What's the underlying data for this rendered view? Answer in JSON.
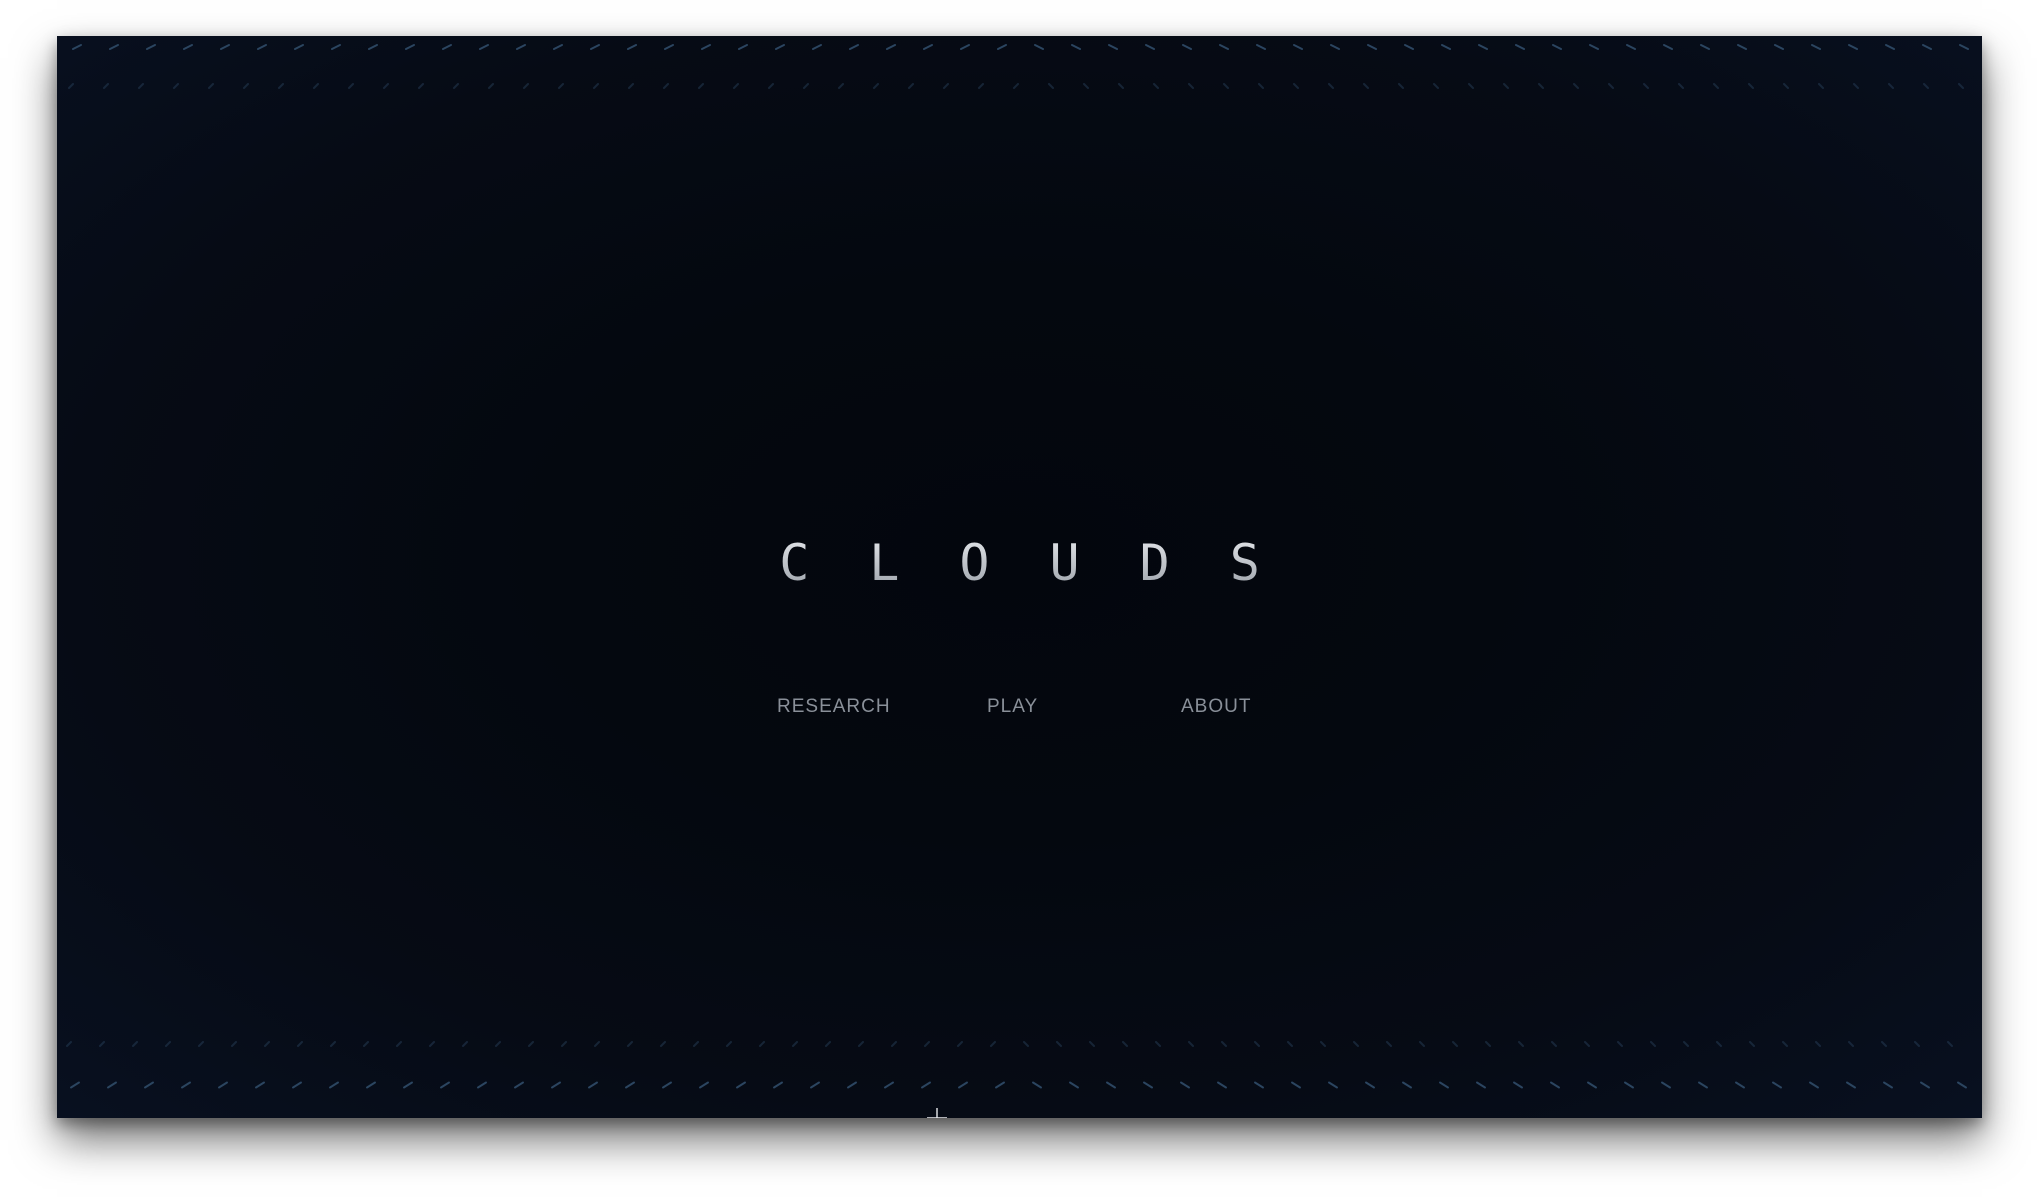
{
  "app": {
    "title": "CLOUDS"
  },
  "nav": {
    "items": [
      {
        "label": "RESEARCH"
      },
      {
        "label": "PLAY"
      },
      {
        "label": "ABOUT"
      }
    ]
  },
  "colors": {
    "background": "#04080f",
    "title": "#c9cdd3",
    "nav_text": "#8a9099",
    "dash": "#2b4560"
  },
  "icons": {
    "cursor": "crosshair-cursor-icon"
  }
}
